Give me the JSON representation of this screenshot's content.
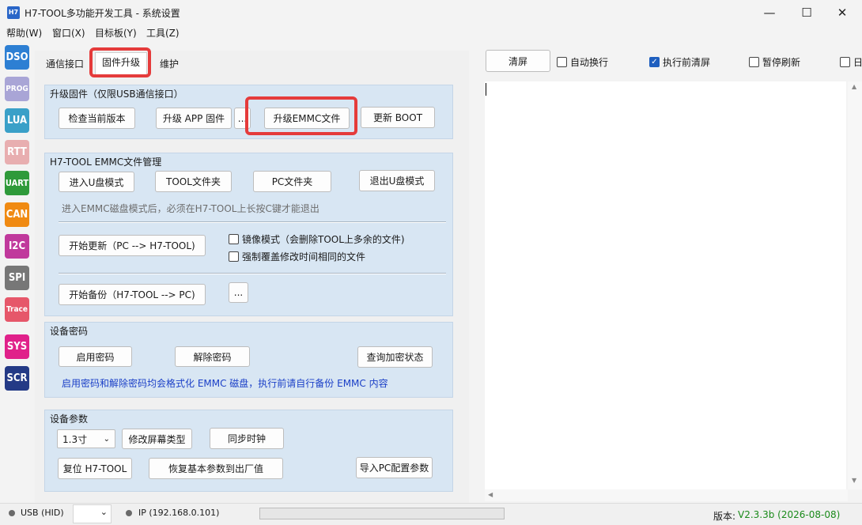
{
  "window": {
    "logo": "H7",
    "title": "H7-TOOL多功能开发工具 - 系统设置",
    "minimize": "—",
    "maximize": "☐",
    "close": "✕"
  },
  "menu": [
    "帮助(W)",
    "窗口(X)",
    "目标板(Y)",
    "工具(Z)"
  ],
  "rail": [
    {
      "label": "DSO",
      "color": "#2d7fd3"
    },
    {
      "label": "PROG",
      "color": "#a9a5d6"
    },
    {
      "label": "LUA",
      "color": "#3aa0c8"
    },
    {
      "label": "RTT",
      "color": "#e8aeb0"
    },
    {
      "label": "UART",
      "color": "#2f9a3a"
    },
    {
      "label": "CAN",
      "color": "#f08a12"
    },
    {
      "label": "I2C",
      "color": "#c0399c"
    },
    {
      "label": "SPI",
      "color": "#777777"
    },
    {
      "label": "Trace",
      "color": "#e6576a"
    },
    {
      "label": "SYS",
      "color": "#e0218a"
    },
    {
      "label": "SCR",
      "color": "#243a86"
    }
  ],
  "tabs": {
    "comm": "通信接口",
    "upgrade": "固件升级",
    "maintain": "维护"
  },
  "upgrade": {
    "title": "升级固件（仅限USB通信接口）",
    "check": "检查当前版本",
    "app": "升级 APP 固件",
    "more": "...",
    "emmc": "升级EMMC文件",
    "boot": "更新 BOOT"
  },
  "emmc": {
    "title": "H7-TOOL EMMC文件管理",
    "enter_udisk": "进入U盘模式",
    "tool_folder": "TOOL文件夹",
    "pc_folder": "PC文件夹",
    "exit_udisk": "退出U盘模式",
    "hint": "进入EMMC磁盘模式后，必须在H7-TOOL上长按C键才能退出",
    "start_update": "开始更新（PC --> H7-TOOL)",
    "mirror": "镜像模式（会删除TOOL上多余的文件)",
    "force": "强制覆盖修改时间相同的文件",
    "start_backup": "开始备份（H7-TOOL --> PC)",
    "more": "..."
  },
  "password": {
    "title": "设备密码",
    "enable": "启用密码",
    "disable": "解除密码",
    "query": "查询加密状态",
    "note": "启用密码和解除密码均会格式化 EMMC 磁盘，执行前请自行备份 EMMC 内容"
  },
  "params": {
    "title": "设备参数",
    "screen": "1.3寸",
    "modify_screen": "修改屏幕类型",
    "sync_clock": "同步时钟",
    "reset": "复位 H7-TOOL",
    "restore": "恢复基本参数到出厂值",
    "import": "导入PC配置参数"
  },
  "right": {
    "clear": "清屏",
    "auto_wrap": "自动换行",
    "clear_before": "执行前清屏",
    "pause_refresh": "暂停刷新",
    "cut": "日"
  },
  "status": {
    "usb": "USB (HID)",
    "ip": "IP (192.168.0.101)",
    "version_label": "版本:",
    "version": "V2.3.3b (2026-08-08)"
  },
  "colors": {
    "highlight": "#e53b3b",
    "group_bg": "#d8e6f3",
    "note": "#1a3fc7",
    "version": "#1a8a1a"
  }
}
